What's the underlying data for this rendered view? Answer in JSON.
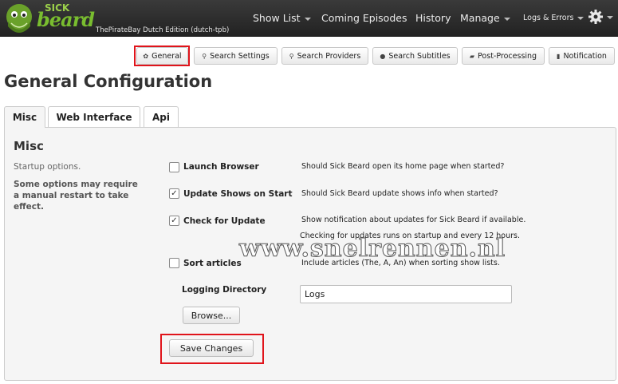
{
  "header": {
    "logo_small": "SICK",
    "logo_large": "beard",
    "edition": "ThePirateBay Dutch Edition (dutch-tpb)",
    "nav": [
      {
        "label": "Show List",
        "dropdown": true
      },
      {
        "label": "Coming Episodes",
        "dropdown": false
      },
      {
        "label": "History",
        "dropdown": false
      },
      {
        "label": "Manage",
        "dropdown": true
      },
      {
        "label": "Logs & Errors",
        "dropdown": true
      }
    ],
    "settings_icon": "gear-icon"
  },
  "config_nav": [
    {
      "label": "General",
      "icon": "gear-icon",
      "highlighted": true
    },
    {
      "label": "Search Settings",
      "icon": "search-icon"
    },
    {
      "label": "Search Providers",
      "icon": "search-icon"
    },
    {
      "label": "Search Subtitles",
      "icon": "subtitle-icon"
    },
    {
      "label": "Post-Processing",
      "icon": "folder-icon"
    },
    {
      "label": "Notification",
      "icon": "notification-icon"
    }
  ],
  "page_title": "General Configuration",
  "tabs": [
    {
      "label": "Misc",
      "active": true
    },
    {
      "label": "Web Interface",
      "active": false
    },
    {
      "label": "Api",
      "active": false
    }
  ],
  "misc": {
    "title": "Misc",
    "subtitle": "Startup options.",
    "note": "Some options may require a manual restart to take effect.",
    "options": [
      {
        "label": "Launch Browser",
        "checked": false,
        "desc": "Should Sick Beard open its home page when started?"
      },
      {
        "label": "Update Shows on Start",
        "checked": true,
        "desc": "Should Sick Beard update shows info when started?"
      },
      {
        "label": "Check for Update",
        "checked": true,
        "desc": "Show notification about updates for Sick Beard if available.",
        "desc2": "Checking for updates runs on startup and every 12 hours."
      },
      {
        "label": "Sort articles",
        "checked": false,
        "desc": "Include articles (The, A, An) when sorting show lists."
      }
    ],
    "logging_label": "Logging Directory",
    "logging_value": "Logs",
    "browse_label": "Browse...",
    "save_label": "Save Changes"
  },
  "watermark": "www.snelrennen.nl",
  "colors": {
    "highlight": "#e0141b",
    "topbar": "#2b2b2b",
    "logo_green": "#79bd2f"
  }
}
